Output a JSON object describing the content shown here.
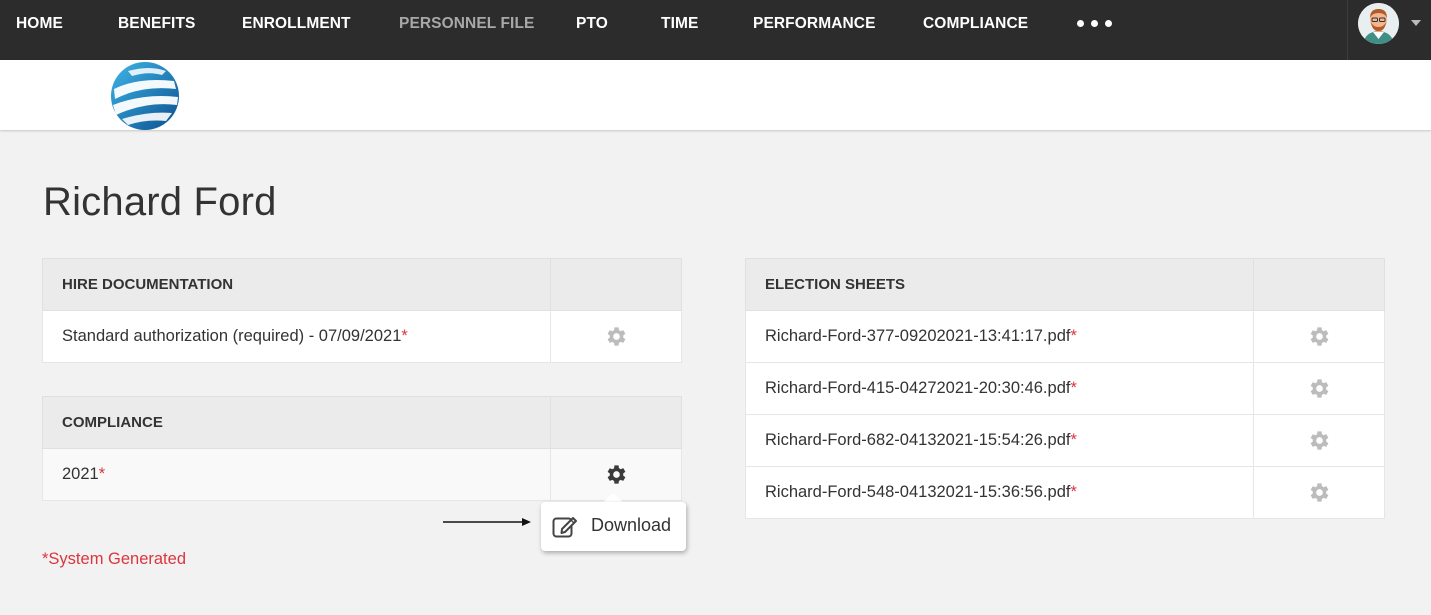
{
  "nav": {
    "items": [
      {
        "label": "HOME"
      },
      {
        "label": "BENEFITS"
      },
      {
        "label": "ENROLLMENT"
      },
      {
        "label": "PERSONNEL FILE"
      },
      {
        "label": "PTO"
      },
      {
        "label": "TIME"
      },
      {
        "label": "PERFORMANCE"
      },
      {
        "label": "COMPLIANCE"
      }
    ],
    "active_item": "PERSONNEL FILE",
    "more_icon": "more-dots-icon",
    "avatar_icon": "user-avatar-icon",
    "dropdown_icon": "caret-down-icon"
  },
  "header": {
    "logo_icon": "globe-logo-icon"
  },
  "page": {
    "title": "Richard Ford"
  },
  "hire_documentation": {
    "header": "HIRE DOCUMENTATION",
    "rows": [
      {
        "name": "Standard authorization (required) - 07/09/2021",
        "required_mark": "*"
      }
    ]
  },
  "compliance": {
    "header": "COMPLIANCE",
    "rows": [
      {
        "name": "2021",
        "required_mark": "*"
      }
    ]
  },
  "election_sheets": {
    "header": "ELECTION SHEETS",
    "rows": [
      {
        "name": "Richard-Ford-377-09202021-13:41:17.pdf",
        "required_mark": "*"
      },
      {
        "name": "Richard-Ford-415-04272021-20:30:46.pdf",
        "required_mark": "*"
      },
      {
        "name": "Richard-Ford-682-04132021-15:54:26.pdf",
        "required_mark": "*"
      },
      {
        "name": "Richard-Ford-548-04132021-15:36:56.pdf",
        "required_mark": "*"
      }
    ]
  },
  "popover": {
    "label": "Download",
    "icon": "edit-icon"
  },
  "legend": {
    "mark": "*",
    "text": "System Generated"
  },
  "colors": {
    "nav_bg": "#2c2c2c",
    "required": "#d9363e",
    "gear_idle": "#bcbcbc",
    "gear_active": "#3a3a3a"
  }
}
